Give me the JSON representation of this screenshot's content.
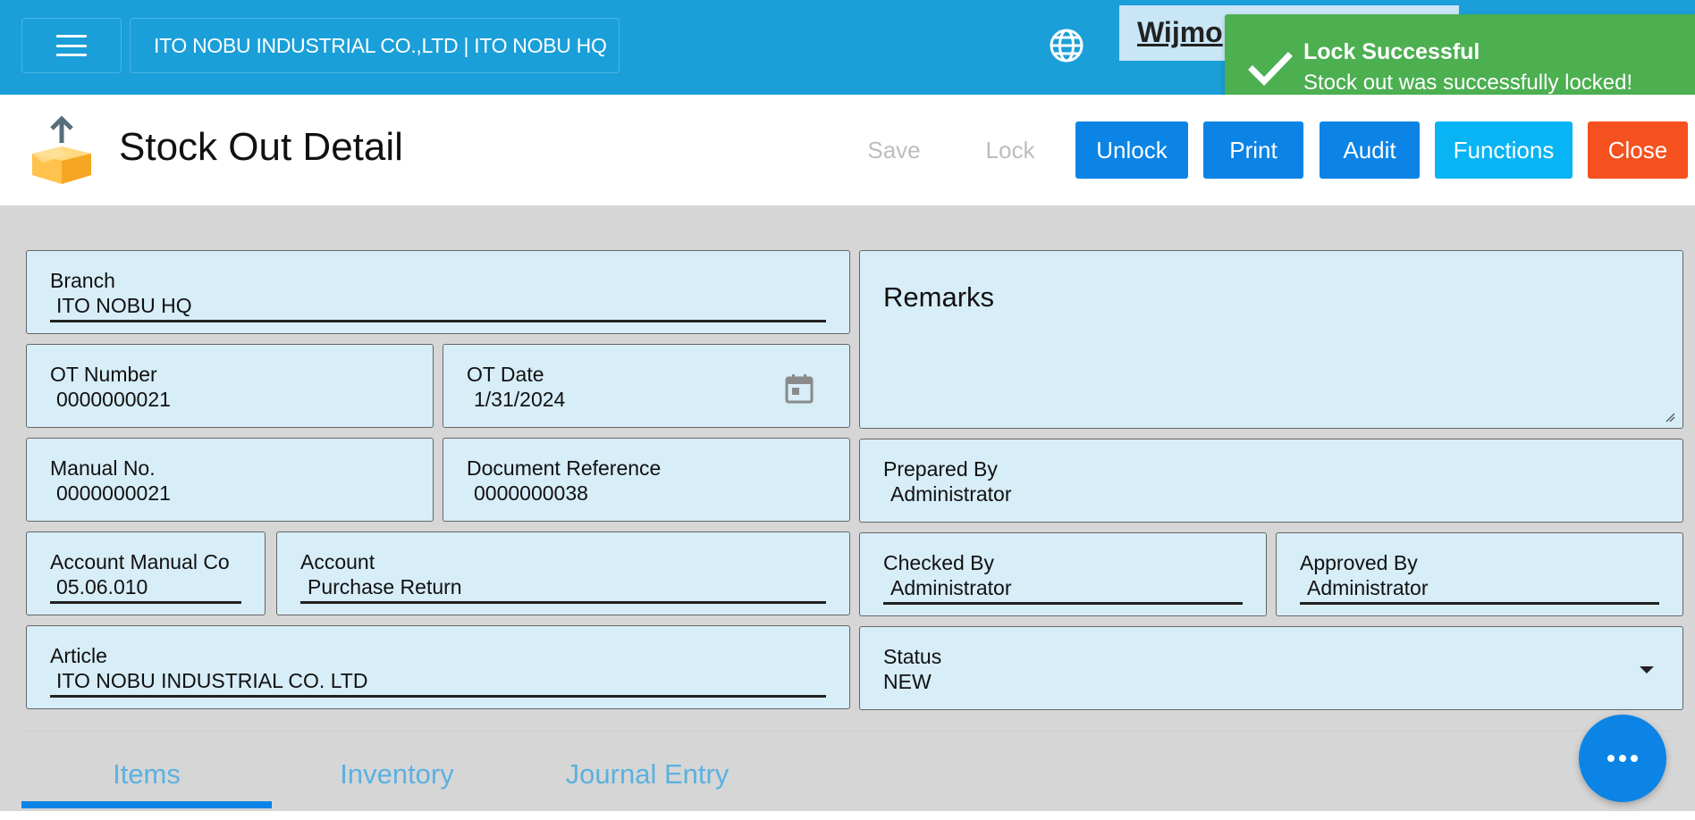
{
  "topbar": {
    "company": "ITO NOBU INDUSTRIAL CO.,LTD | ITO NOBU HQ",
    "overlay_text": "Wijmo",
    "icons": {
      "menu": "hamburger-menu-icon",
      "language": "globe-icon"
    }
  },
  "toast": {
    "title": "Lock Successful",
    "message": "Stock out was successfully locked!",
    "icon": "checkmark-icon",
    "color": "#4caf50"
  },
  "header": {
    "title": "Stock Out Detail",
    "icon": "stock-out-box-icon",
    "buttons": {
      "save": "Save",
      "lock": "Lock",
      "unlock": "Unlock",
      "print": "Print",
      "audit": "Audit",
      "functions": "Functions",
      "close": "Close"
    }
  },
  "form": {
    "branch": {
      "label": "Branch",
      "value": "ITO NOBU HQ"
    },
    "ot_number": {
      "label": "OT Number",
      "value": "0000000021"
    },
    "ot_date": {
      "label": "OT Date",
      "value": "1/31/2024"
    },
    "manual_no": {
      "label": "Manual No.",
      "value": "0000000021"
    },
    "document_reference": {
      "label": "Document Reference",
      "value": "0000000038"
    },
    "account_manual_code": {
      "label": "Account Manual Co",
      "value": "05.06.010"
    },
    "account": {
      "label": "Account",
      "value": "Purchase Return"
    },
    "article": {
      "label": "Article",
      "value": "ITO NOBU INDUSTRIAL CO. LTD"
    },
    "remarks": {
      "label": "Remarks",
      "value": ""
    },
    "prepared_by": {
      "label": "Prepared By",
      "value": "Administrator"
    },
    "checked_by": {
      "label": "Checked By",
      "value": "Administrator"
    },
    "approved_by": {
      "label": "Approved By",
      "value": "Administrator"
    },
    "status": {
      "label": "Status",
      "value": "NEW"
    }
  },
  "tabs": [
    {
      "label": "Items",
      "active": true
    },
    {
      "label": "Inventory",
      "active": false
    },
    {
      "label": "Journal Entry",
      "active": false
    }
  ],
  "colors": {
    "topbar": "#1a9fd9",
    "primary_button": "#0b84e6",
    "functions_button": "#08b4f4",
    "close_button": "#f4511e",
    "field_background": "#d7edf7",
    "page_background": "#d6d6d6"
  }
}
